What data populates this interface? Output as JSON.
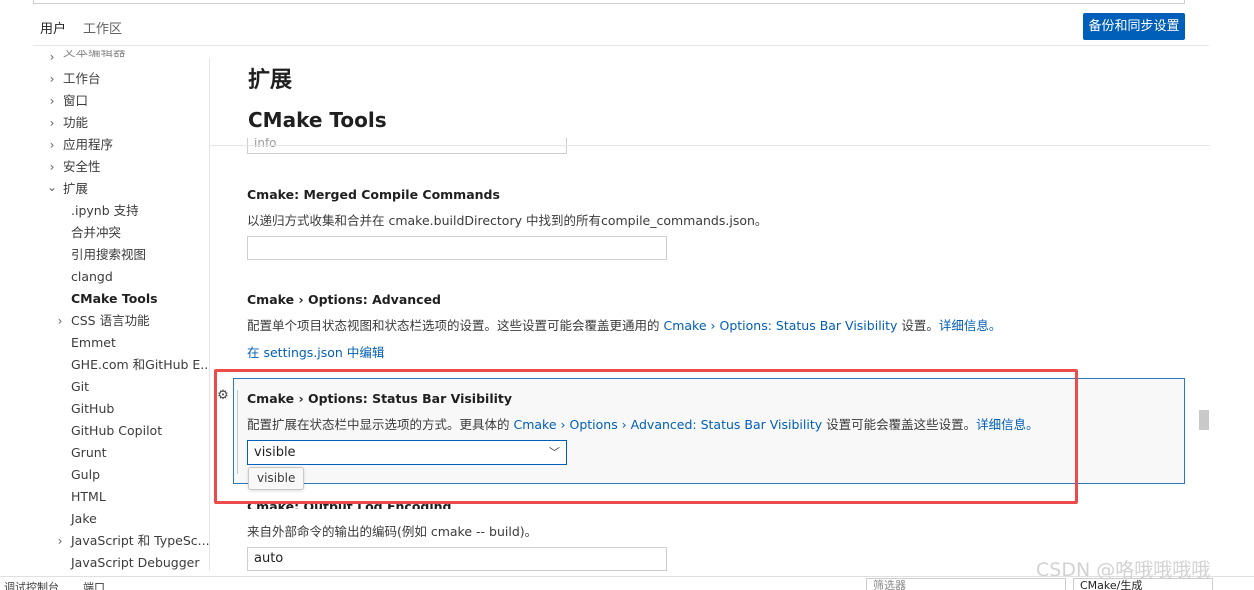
{
  "scope_tabs": {
    "user": "用户",
    "workspace": "工作区"
  },
  "sync_button": "备份和同步设置",
  "toc": {
    "cut_item": "文本编辑器",
    "top_level": [
      "工作台",
      "窗口",
      "功能",
      "应用程序",
      "安全性",
      "扩展"
    ],
    "extensions": [
      ".ipynb 支持",
      "合并冲突",
      "引用搜索视图",
      "clangd",
      "CMake Tools",
      "CSS 语言功能",
      "Emmet",
      "GHE.com 和GitHub E...",
      "Git",
      "GitHub",
      "GitHub Copilot",
      "Grunt",
      "Gulp",
      "HTML",
      "Jake",
      "JavaScript 和 TypeSc...",
      "JavaScript Debugger"
    ]
  },
  "main": {
    "section_title": "扩展",
    "subsection_title": "CMake Tools",
    "cut_input_value": "info",
    "merged": {
      "prefix": "Cmake: ",
      "name": "Merged Compile Commands",
      "description": "以递归方式收集和合并在 cmake.buildDirectory 中找到的所有compile_commands.json。",
      "value": ""
    },
    "advanced": {
      "prefix": "Cmake › Options: ",
      "name": "Advanced",
      "desc_before": "配置单个项目状态视图和状态栏选项的设置。这些设置可能会覆盖更通用的 ",
      "desc_link": "Cmake › Options: Status Bar Visibility",
      "desc_after": " 设置。",
      "more_info": "详细信息。",
      "edit_link": "在 settings.json 中编辑"
    },
    "status_bar": {
      "prefix": "Cmake › Options: ",
      "name": "Status Bar Visibility",
      "desc_before": "配置扩展在状态栏中显示选项的方式。更具体的 ",
      "desc_link": "Cmake › Options › Advanced: Status Bar Visibility",
      "desc_after": " 设置可能会覆盖这些设置。",
      "more_info": "详细信息。",
      "selected_value": "visible",
      "tooltip": "visible"
    },
    "output_log": {
      "title_partial": "Cmake: Output Log Encoding",
      "description": "来自外部命令的输出的编码(例如 cmake -- build)。",
      "value": "auto"
    }
  },
  "panel": {
    "tab_debug_console": "调试控制台",
    "tab_ports": "端口",
    "filter_placeholder": "筛选器",
    "channel": "CMake/生成"
  },
  "watermark": "CSDN @咯哦哦哦哦"
}
